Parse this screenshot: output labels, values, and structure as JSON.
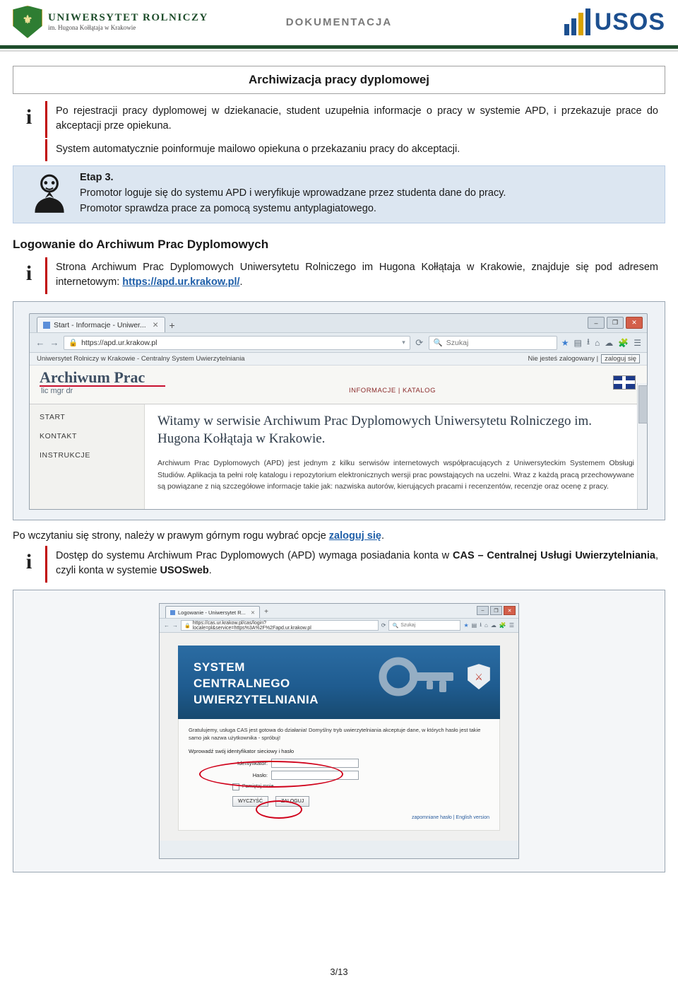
{
  "header": {
    "university_line1": "UNIWERSYTET ROLNICZY",
    "university_line2": "im. Hugona Kołłątaja w Krakowie",
    "doc_label": "DOKUMENTACJA",
    "usos_text": "USOS",
    "crest_icon": "coat-of-arms-icon"
  },
  "title": "Archiwizacja pracy dyplomowej",
  "info1": {
    "icon": "i",
    "text": "Po rejestracji pracy dyplomowej w dziekanacie, student uzupełnia informacje o pracy w systemie APD, i przekazuje prace do akceptacji prze opiekuna."
  },
  "info2": {
    "text": "System automatycznie poinformuje mailowo opiekuna o przekazaniu pracy do akceptacji."
  },
  "stage": {
    "icon": "promoter-avatar-icon",
    "label": "Etap 3.",
    "line1": "Promotor loguje się do systemu APD i weryfikuje wprowadzane przez studenta dane do pracy.",
    "line2": "Promotor sprawdza prace za pomocą systemu antyplagiatowego."
  },
  "section_heading": "Logowanie do Archiwum Prac Dyplomowych",
  "info3": {
    "icon": "i",
    "text_before": "Strona Archiwum Prac Dyplomowych Uniwersytetu Rolniczego im Hugona Kołłątaja w Krakowie,  znajduje się pod adresem internetowym: ",
    "link": "https://apd.ur.krakow.pl/",
    "text_after": "."
  },
  "screenshot1": {
    "tab_title": "Start - Informacje - Uniwer...",
    "tab_close": "✕",
    "new_tab": "+",
    "window_controls": [
      "–",
      "❐",
      "✕"
    ],
    "url": "https://apd.ur.krakow.pl",
    "search_placeholder": "Szukaj",
    "reload_icon": "reload-icon",
    "back_icon": "back-arrow-icon",
    "forward_icon": "forward-arrow-icon",
    "status_left": "Uniwersytet Rolniczy w Krakowie - Centralny System Uwierzytelniania",
    "status_right_text": "Nie jesteś zalogowany |",
    "login_link": "zaloguj się",
    "site_title": "Archiwum Prac",
    "site_subtitle": "lic mgr dr",
    "menu": "INFORMACJE  |  KATALOG",
    "flag_icon": "uk-flag-icon",
    "sidebar": [
      "START",
      "KONTAKT",
      "INSTRUKCJE"
    ],
    "main_heading": "Witamy w serwisie Archiwum Prac Dyplomowych Uniwersytetu Rolniczego im. Hugona Kołłątaja w Krakowie.",
    "main_paragraph": "Archiwum Prac Dyplomowych (APD) jest jednym z kilku serwisów internetowych współpracujących z Uniwersyteckim Systemem Obsługi Studiów. Aplikacja ta pełni rolę katalogu i repozytorium elektronicznych wersji prac powstających na uczelni. Wraz z każdą pracą przechowywane są powiązane z nią szczegółowe informacje takie jak: nazwiska autorów, kierujących pracami i recenzentów, recenzje oraz ocenę z pracy.",
    "scrollbar": "vertical-scrollbar"
  },
  "caption": {
    "text_before": "Po wczytaniu się strony, należy w prawym górnym rogu wybrać opcje ",
    "highlight": "zaloguj się",
    "text_after": "."
  },
  "info4": {
    "icon": "i",
    "text_before": "Dostęp do systemu Archiwum Prac Dyplomowych (APD) wymaga posiadania konta w ",
    "bold1": "CAS – Centralnej Usługi Uwierzytelniania",
    "text_mid": ", czyli konta w systemie ",
    "bold2": "USOSweb",
    "text_after": "."
  },
  "screenshot2": {
    "tab_title": "Logowanie - Uniwersytet R...",
    "tab_close": "✕",
    "new_tab": "+",
    "window_controls": [
      "–",
      "❐",
      "✕"
    ],
    "url": "https://cas.ur.krakow.pl/cas/login?locale=pl&service=https%3A%2F%2Fapd.ur.krakow.pl",
    "search_placeholder": "Szukaj",
    "banner_line1": "SYSTEM",
    "banner_line2": "CENTRALNEGO",
    "banner_line3": "UWIERZYTELNIANIA",
    "key_icon": "key-icon",
    "crest_icon": "coat-of-arms-icon",
    "intro": "Gratulujemy, usługa CAS jest gotowa do działania! Domyślny tryb uwierzytelniania akceptuje dane, w których hasło jest takie samo jak nazwa użytkownika - spróbuj!",
    "prompt": "Wprowadź swój identyfikator sieciowy i hasło",
    "field_user_label": "Identyfikator:",
    "field_pass_label": "Hasło:",
    "remember_label": "Pamiętaj mnie",
    "button_clear": "WYCZYŚĆ",
    "button_login": "ZALOGUJ",
    "links": "zapomniane hasło | English version"
  },
  "footer": {
    "page": "3/13"
  }
}
